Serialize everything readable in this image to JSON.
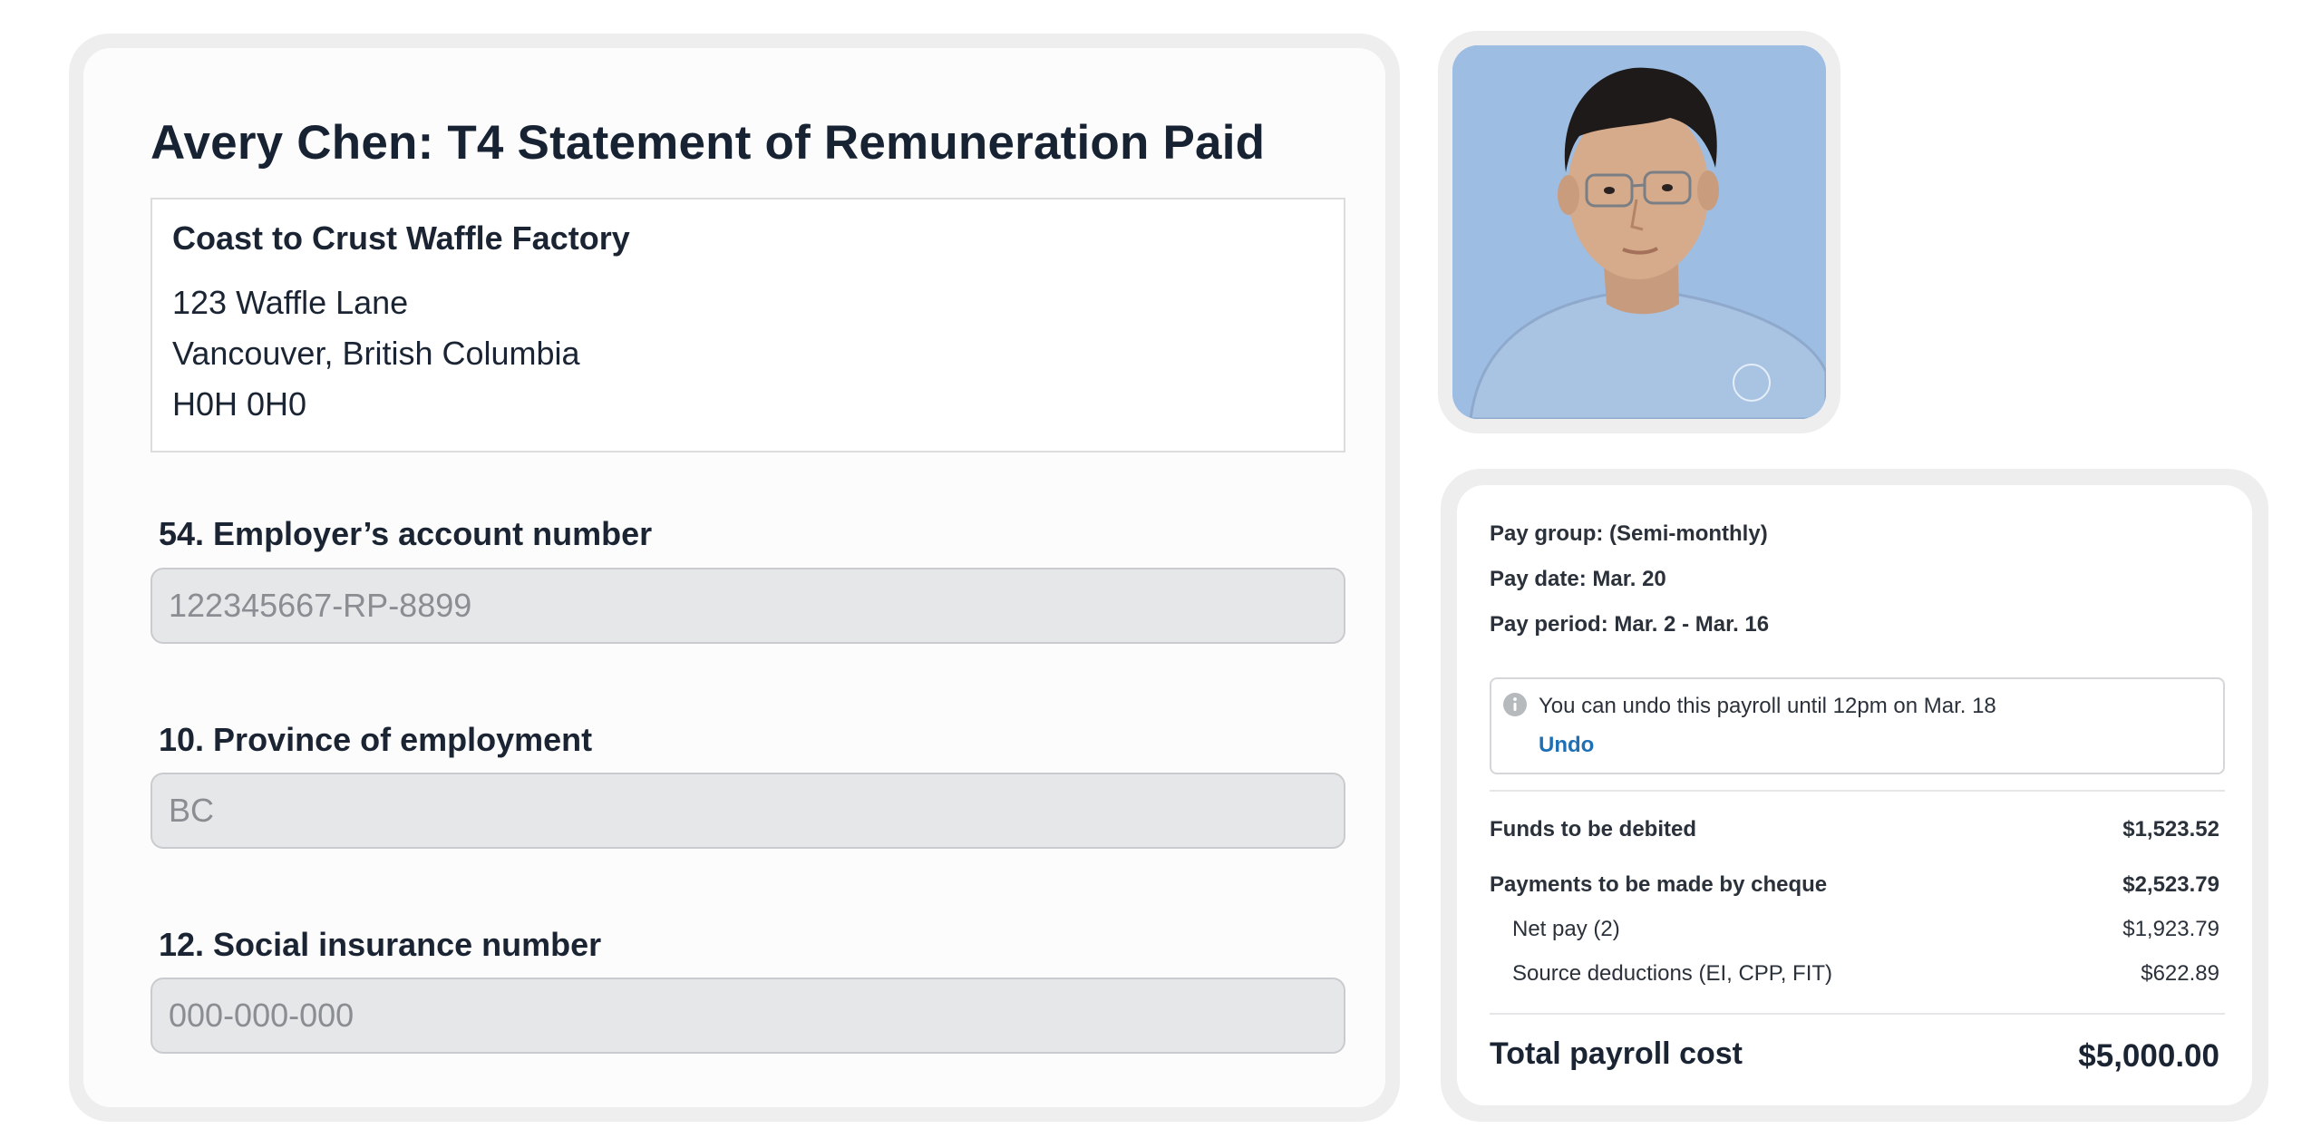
{
  "t4": {
    "title": "Avery Chen: T4 Statement of Remuneration Paid",
    "employer": {
      "name": "Coast to Crust Waffle Factory",
      "address_line1": "123 Waffle Lane",
      "address_line2": "Vancouver, British Columbia",
      "postal_code": "H0H 0H0"
    },
    "fields": [
      {
        "label": "54. Employer’s account number",
        "placeholder": "122345667-RP-8899"
      },
      {
        "label": "10. Province of employment",
        "placeholder": "BC"
      },
      {
        "label": "12. Social insurance number",
        "placeholder": "000-000-000"
      }
    ]
  },
  "profile_photo": {
    "background_color": "#9dbde2"
  },
  "payroll": {
    "pay_group": "Pay group: (Semi-monthly)",
    "pay_date": "Pay date: Mar. 20",
    "pay_period": "Pay period: Mar. 2 - Mar. 16",
    "notice": {
      "icon": "info-icon",
      "text": "You can undo this payroll until 12pm on Mar. 18",
      "link_label": "Undo"
    },
    "rows": [
      {
        "label": "Funds to be debited",
        "value": "$1,523.52"
      },
      {
        "label": "Payments to be made by cheque",
        "value": "$2,523.79"
      },
      {
        "label": "Net pay (2)",
        "value": "$1,923.79"
      },
      {
        "label": "Source deductions (EI, CPP, FIT)",
        "value": "$622.89"
      }
    ],
    "total": {
      "label": "Total payroll cost",
      "value": "$5,000.00"
    },
    "link_color": "#1f6fb5"
  }
}
